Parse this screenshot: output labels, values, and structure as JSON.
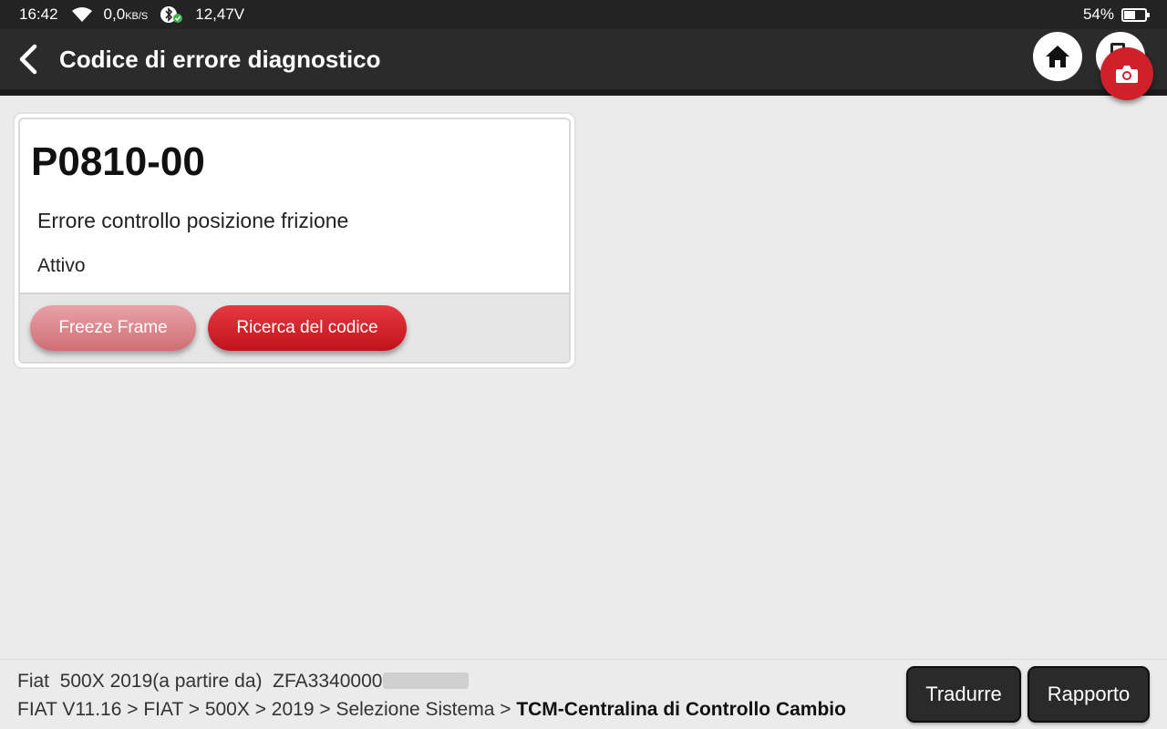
{
  "status_bar": {
    "time": "16:42",
    "data_rate_value": "0,0",
    "data_rate_unit": "KB/S",
    "voltage": "12,47V",
    "battery_percent": "54%",
    "battery_level": 0.54
  },
  "header": {
    "title": "Codice di errore diagnostico",
    "icons": [
      "back-icon",
      "home-icon",
      "document-icon",
      "camera-icon"
    ]
  },
  "dtc": {
    "code": "P0810-00",
    "description": "Errore controllo posizione frizione",
    "status": "Attivo",
    "actions": {
      "freeze_frame": "Freeze Frame",
      "code_search": "Ricerca del codice"
    }
  },
  "footer": {
    "make": "Fiat",
    "model_year": "500X 2019(a partire da)",
    "vin_visible": "ZFA3340000",
    "path_prefix": "FIAT V11.16 > FIAT > 500X > 2019 > Selezione Sistema > ",
    "path_current": "TCM-Centralina di Controllo Cambio",
    "translate_label": "Tradurre",
    "report_label": "Rapporto"
  },
  "colors": {
    "accent_red": "#d0202a",
    "header_bg": "#2b2b2b",
    "page_bg": "#ebebeb"
  }
}
